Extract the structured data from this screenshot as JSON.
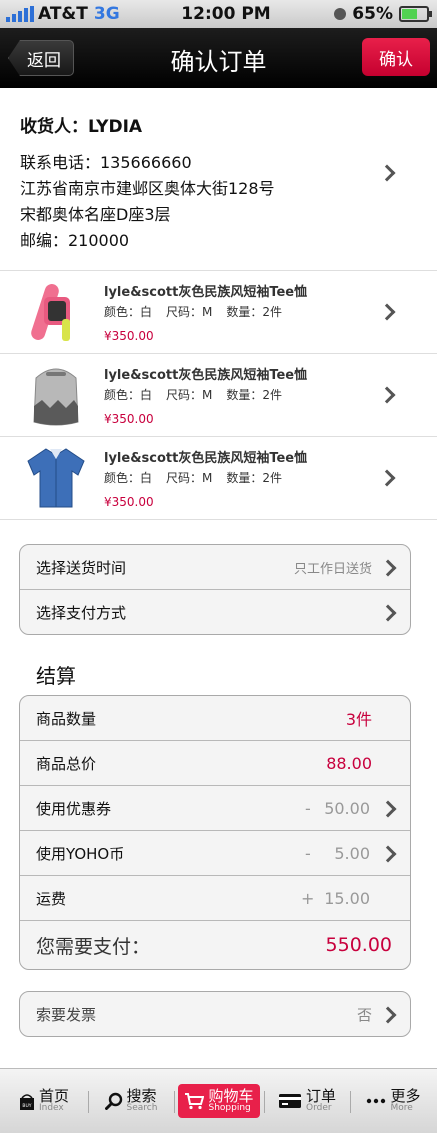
{
  "status": {
    "carrier": "AT&T",
    "network": "3G",
    "time": "12:00 PM",
    "battery": "65%"
  },
  "nav": {
    "back": "返回",
    "title": "确认订单",
    "confirm": "确认"
  },
  "address": {
    "name": "收货人：LYDIA",
    "phone": "联系电话：135666660",
    "line1": "江苏省南京市建邺区奥体大街128号",
    "line2": "宋都奥体名座D座3层",
    "zip": "邮编：210000"
  },
  "products": [
    {
      "title": "lyle&scott灰色民族风短袖Tee恤",
      "color": "颜色：白",
      "size": "尺码：M",
      "qty": "数量：2件",
      "price": "¥350.00",
      "image": "watch"
    },
    {
      "title": "lyle&scott灰色民族风短袖Tee恤",
      "color": "颜色：白",
      "size": "尺码：M",
      "qty": "数量：2件",
      "price": "¥350.00",
      "image": "backpack"
    },
    {
      "title": "lyle&scott灰色民族风短袖Tee恤",
      "color": "颜色：白",
      "size": "尺码：M",
      "qty": "数量：2件",
      "price": "¥350.00",
      "image": "shirt"
    }
  ],
  "delivery": {
    "label": "选择送货时间",
    "hint": "只工作日送货"
  },
  "payment": {
    "label": "选择支付方式"
  },
  "settlement": {
    "title": "结算",
    "count_label": "商品数量",
    "count_value": "3件",
    "total_label": "商品总价",
    "total_value": "88.00",
    "coupon_label": "使用优惠券",
    "coupon_sign": "-",
    "coupon_value": "50.00",
    "yoho_label": "使用YOHO币",
    "yoho_sign": "-",
    "yoho_value": "5.00",
    "freight_label": "运费",
    "freight_sign": "+",
    "freight_value": "15.00",
    "pay_label": "您需要支付：",
    "pay_value": "550.00"
  },
  "invoice": {
    "label": "索要发票",
    "value": "否"
  },
  "tabs": [
    {
      "zh": "首页",
      "en": "Index",
      "icon": "buy-bag-icon"
    },
    {
      "zh": "搜索",
      "en": "Search",
      "icon": "search-icon"
    },
    {
      "zh": "购物车",
      "en": "Shopping",
      "icon": "cart-icon",
      "active": true
    },
    {
      "zh": "订单",
      "en": "Order",
      "icon": "card-icon"
    },
    {
      "zh": "更多",
      "en": "More",
      "icon": "more-icon"
    }
  ],
  "colors": {
    "accent": "#e8204a",
    "price": "#c8003d"
  }
}
